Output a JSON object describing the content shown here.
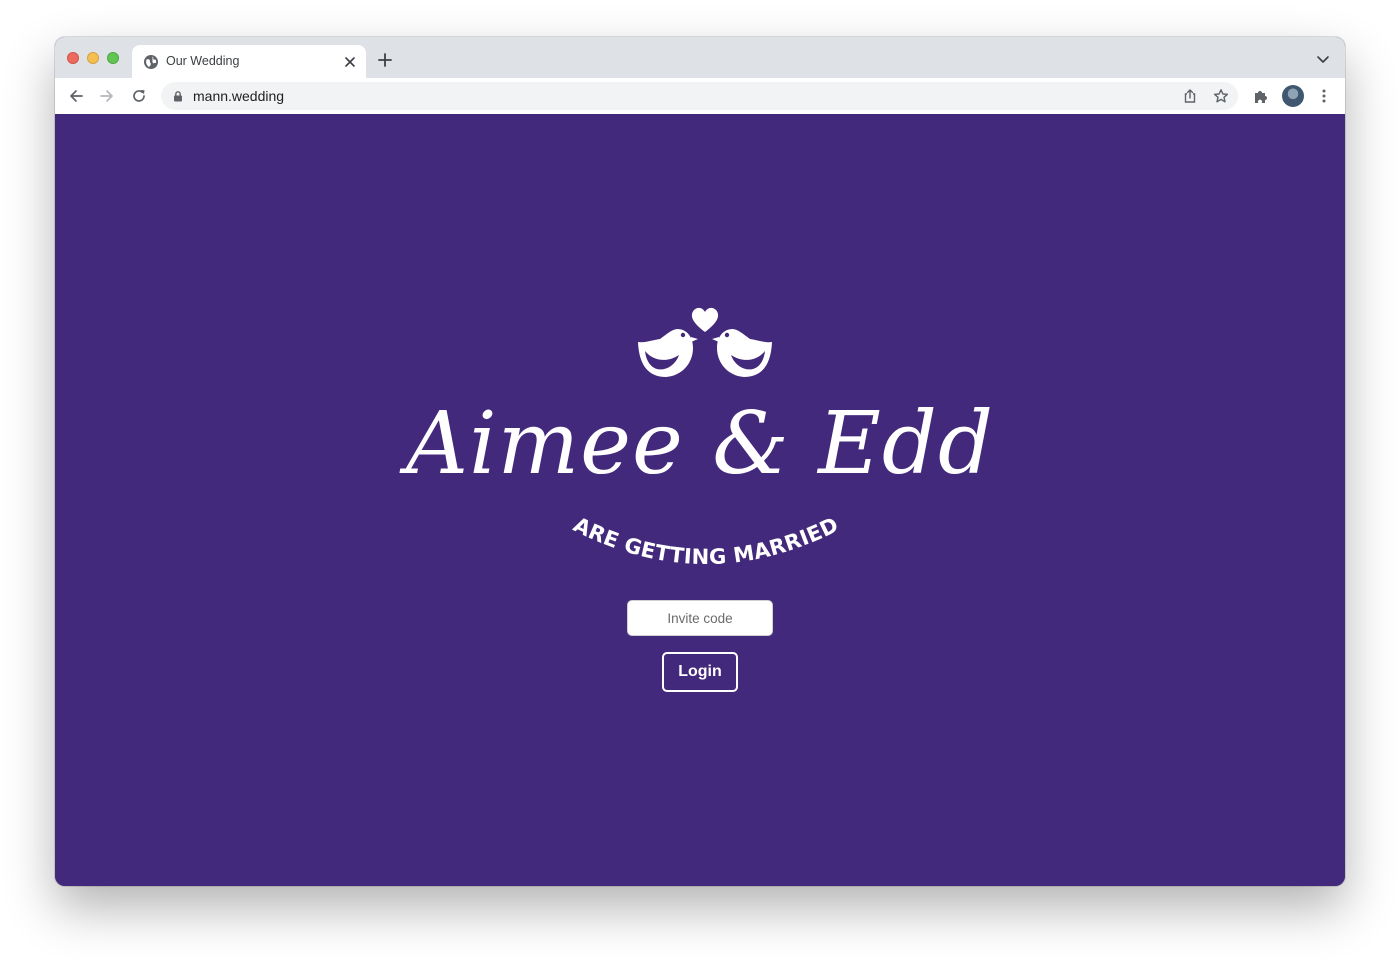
{
  "browser": {
    "tab": {
      "title": "Our Wedding",
      "favicon": "globe-icon"
    },
    "address_bar": {
      "url": "mann.wedding",
      "secure_icon": "lock-icon"
    },
    "toolbar_icons": [
      "back-arrow-icon",
      "forward-arrow-icon",
      "reload-icon",
      "share-icon",
      "star-icon",
      "puzzle-icon",
      "kebab-menu-icon"
    ]
  },
  "page": {
    "background_color": "#43297c",
    "logo": "lovebirds-heart-icon",
    "names": "Aimee & Edd",
    "tagline": "ARE GETTING MARRIED",
    "invite_placeholder": "Invite code",
    "login_label": "Login"
  }
}
